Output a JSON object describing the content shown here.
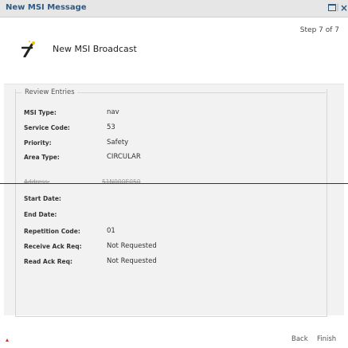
{
  "window": {
    "title": "New MSI Message",
    "separator": "|",
    "close_glyph": "×"
  },
  "wizard": {
    "step": "Step 7 of 7",
    "heading": "New MSI Broadcast",
    "icon": "wand-icon"
  },
  "review": {
    "legend": "Review Entries",
    "fields": [
      {
        "label": "MSI Type:",
        "value": "nav"
      },
      {
        "label": "Service Code:",
        "value": "53"
      },
      {
        "label": "Priority:",
        "value": "Safety"
      },
      {
        "label": "Area Type:",
        "value": "CIRCULAR"
      },
      {
        "label": "Address:",
        "value": "51N000E050"
      },
      {
        "label": "Start Date:",
        "value": ""
      },
      {
        "label": "End Date:",
        "value": ""
      },
      {
        "label": "Repetition Code:",
        "value": "01"
      },
      {
        "label": "Receive Ack Req:",
        "value": "Not Requested"
      },
      {
        "label": "Read Ack Req:",
        "value": "Not Requested"
      }
    ]
  },
  "footer": {
    "back_label": "Back",
    "finish_label": "Finish"
  }
}
